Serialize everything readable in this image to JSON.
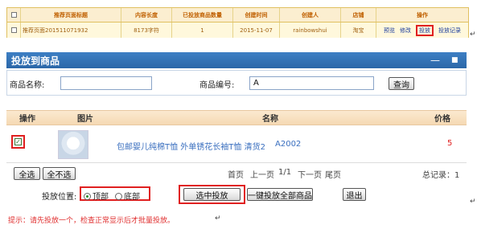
{
  "top_table": {
    "headers": [
      "推荐页面标题",
      "内容长度",
      "已投放商品数量",
      "创建时间",
      "创建人",
      "店铺",
      "操作"
    ],
    "row": {
      "title": "推荐页面201511071932",
      "length": "8173字符",
      "count": "1",
      "created": "2015-11-07",
      "creator": "rainbowshui",
      "shop": "淘宝",
      "ops": [
        "预览",
        "修改",
        "投放",
        "投放记录"
      ]
    }
  },
  "panel": {
    "title": "投放到商品",
    "controls": {
      "minimize": "—",
      "close": "■"
    },
    "search": {
      "name_label": "商品名称:",
      "name_value": "",
      "code_label": "商品编号:",
      "code_value": "A",
      "query_button": "查询"
    },
    "grid_headers": {
      "op": "操作",
      "image": "图片",
      "name": "名称",
      "price": "价格"
    },
    "rows": [
      {
        "checked": true,
        "name": "包邮婴儿纯棉T恤 外单锈花长袖T恤 清货2",
        "code": "A2002",
        "price": "5"
      }
    ],
    "buttons": {
      "select_all": "全选",
      "select_none": "全不选"
    },
    "pager": {
      "first": "首页",
      "prev": "上一页",
      "page": "1/1",
      "next": "下一页",
      "last": "尾页",
      "total": "总记录：1"
    },
    "position_label": "投放位置:",
    "position_options": [
      "顶部",
      "底部"
    ],
    "position_selected": "顶部",
    "actions": {
      "publish_selected": "选中投放",
      "publish_all": "一键投放全部商品",
      "exit": "退出"
    }
  },
  "tip": "提示：请先投放一个，检查正常显示后才批量投放。"
}
